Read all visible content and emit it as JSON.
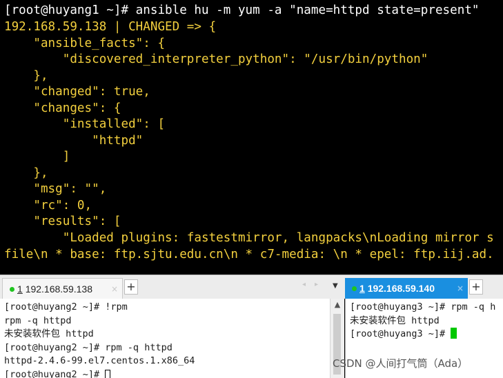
{
  "top_terminal": {
    "lines": [
      "[root@huyang1 ~]# ansible hu -m yum -a \"name=httpd state=present\"",
      "192.168.59.138 | CHANGED => {",
      "    \"ansible_facts\": {",
      "        \"discovered_interpreter_python\": \"/usr/bin/python\"",
      "    },",
      "    \"changed\": true,",
      "    \"changes\": {",
      "        \"installed\": [",
      "            \"httpd\"",
      "        ]",
      "    },",
      "    \"msg\": \"\",",
      "    \"rc\": 0,",
      "    \"results\": [",
      "        \"Loaded plugins: fastestmirror, langpacks\\nLoading mirror s",
      "file\\n * base: ftp.sjtu.edu.cn\\n * c7-media: \\n * epel: ftp.iij.ad."
    ],
    "colors": {
      "prompt": "#ffffff",
      "output": "#f3d03e",
      "background": "#000000"
    }
  },
  "tabs": {
    "left": {
      "index": "1",
      "host": "192.168.59.138",
      "close": "×",
      "add": "+",
      "status_color": "#1fc51f"
    },
    "right": {
      "index": "1",
      "host": "192.168.59.140",
      "close": "×",
      "add": "+",
      "status_color": "#1fc51f",
      "accent": "#1a8fe0"
    },
    "nav_prev": "◂",
    "nav_next": "▸",
    "dropdown": "▼"
  },
  "left_pane": {
    "lines": [
      "[root@huyang2 ~]# !rpm",
      "rpm -q httpd",
      "未安装软件包 httpd",
      "[root@huyang2 ~]# rpm -q httpd",
      "httpd-2.4.6-99.el7.centos.1.x86_64"
    ],
    "last_prompt": "[root@huyang2 ~]# "
  },
  "right_pane": {
    "lines": [
      "[root@huyang3 ~]# rpm -q h",
      "未安装软件包 httpd"
    ],
    "last_prompt": "[root@huyang3 ~]# "
  },
  "scrollbar": {
    "up_arrow": "▲"
  },
  "watermark": "CSDN @人间打气筒（Ada）"
}
